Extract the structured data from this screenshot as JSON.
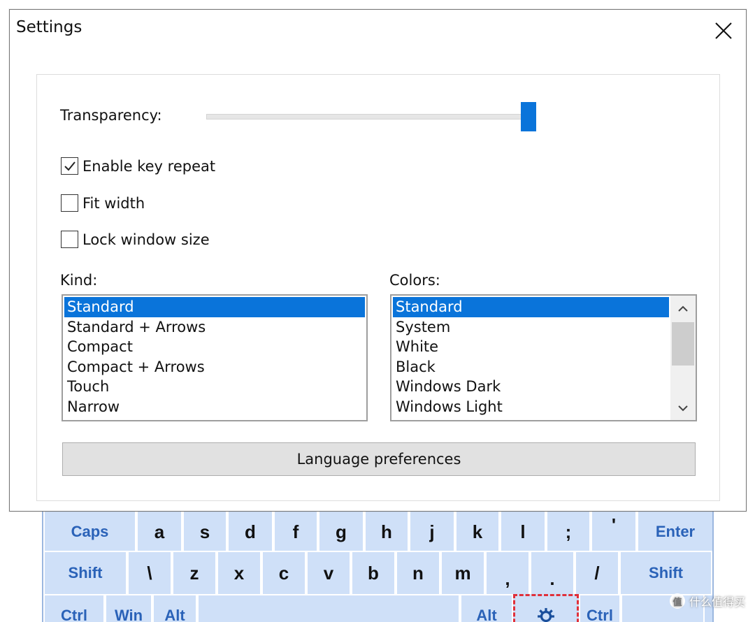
{
  "dialog": {
    "title": "Settings",
    "transparency_label": "Transparency:",
    "transparency_value": 0.97,
    "checkboxes": [
      {
        "label": "Enable key repeat",
        "checked": true
      },
      {
        "label": "Fit width",
        "checked": false
      },
      {
        "label": "Lock window size",
        "checked": false
      }
    ],
    "kind": {
      "label": "Kind:",
      "items": [
        "Standard",
        "Standard + Arrows",
        "Compact",
        "Compact + Arrows",
        "Touch",
        "Narrow"
      ],
      "selected": "Standard"
    },
    "colors": {
      "label": "Colors:",
      "items": [
        "Standard",
        "System",
        "White",
        "Black",
        "Windows Dark",
        "Windows Light"
      ],
      "selected": "Standard"
    },
    "language_button": "Language preferences"
  },
  "keyboard": {
    "row1": [
      "Caps",
      "a",
      "s",
      "d",
      "f",
      "g",
      "h",
      "j",
      "k",
      "l",
      ";",
      "'",
      "Enter"
    ],
    "row2": [
      "Shift",
      "\\",
      "z",
      "x",
      "c",
      "v",
      "b",
      "n",
      "m",
      ",",
      ".",
      "/",
      "Shift"
    ],
    "row3": [
      "Ctrl",
      "Win",
      "Alt",
      "",
      "Alt",
      "",
      "Ctrl",
      ""
    ]
  },
  "watermark": {
    "text": "什么值得买",
    "logo": "值"
  },
  "colors": {
    "accent": "#0a74da",
    "key_bg": "#cfe0f8",
    "key_text": "#1a4f9c",
    "highlight": "#e0303a"
  }
}
